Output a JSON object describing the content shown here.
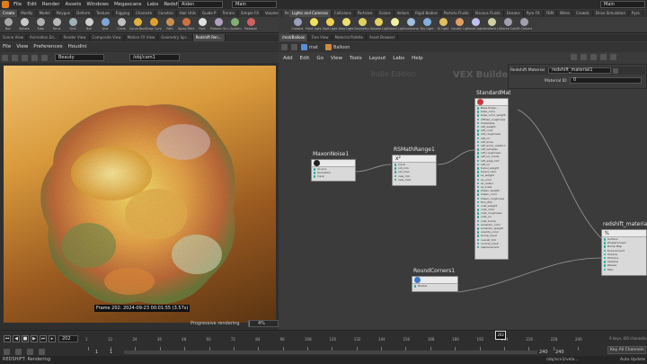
{
  "menubar": {
    "items": [
      "File",
      "Edit",
      "Render",
      "Assets",
      "Windows",
      "Megascans",
      "Labs",
      "Redshift",
      "Help"
    ],
    "desktop": "Aiden",
    "desktop2": "Main"
  },
  "shelf_tabs_left": [
    "Create",
    "Modify",
    "Model",
    "Polygon",
    "Deform",
    "Texture",
    "Rigging",
    "Characte",
    "Constrai",
    "Hair Utils",
    "Guide P",
    "Terrain",
    "Simple FX",
    "Volume",
    "Personal"
  ],
  "shelf_tabs_right": [
    "Lights and Cameras",
    "Collisions",
    "Particles",
    "Grains",
    "Vellum",
    "Rigid Bodies",
    "Particle Fluids",
    "Viscous Fluids",
    "Oceans",
    "Pyro FX",
    "FEM",
    "Wires",
    "Crowds",
    "Drive Simulation",
    "Pyro"
  ],
  "shelf_tools_left": [
    {
      "label": "Box",
      "color": "#a7a7a7"
    },
    {
      "label": "Sphere",
      "color": "#c8c8c8"
    },
    {
      "label": "Tube",
      "color": "#b0b0b0"
    },
    {
      "label": "Torus",
      "color": "#b8b8b8"
    },
    {
      "label": "Grid",
      "color": "#9fb0b8"
    },
    {
      "label": "Null",
      "color": "#d0d0d0"
    },
    {
      "label": "Line",
      "color": "#7fa6d8"
    },
    {
      "label": "Circle",
      "color": "#c0c0c0"
    },
    {
      "label": "Curve Bezier",
      "color": "#e0b040"
    },
    {
      "label": "Draw Curve",
      "color": "#e0a030"
    },
    {
      "label": "Path",
      "color": "#c89050"
    },
    {
      "label": "Spray Paint",
      "color": "#d07040"
    },
    {
      "label": "Font",
      "color": "#e0e0e0"
    },
    {
      "label": "Platonic Solids",
      "color": "#b0a0c0"
    },
    {
      "label": "L-System",
      "color": "#7fb070"
    },
    {
      "label": "Metaball",
      "color": "#d06060"
    }
  ],
  "shelf_tools_right": [
    {
      "label": "Camera",
      "color": "#9aa0c0"
    },
    {
      "label": "Point Light",
      "color": "#f0e060"
    },
    {
      "label": "Spot Light",
      "color": "#f0d050"
    },
    {
      "label": "Area Light",
      "color": "#f0e070"
    },
    {
      "label": "Geometry Light",
      "color": "#e0d060"
    },
    {
      "label": "Volume Light",
      "color": "#e8d060"
    },
    {
      "label": "Distant Light",
      "color": "#f0f0a0"
    },
    {
      "label": "Environment Light",
      "color": "#a0c0e0"
    },
    {
      "label": "Sky Light",
      "color": "#80b0e0"
    },
    {
      "label": "GI Light",
      "color": "#e0c060"
    },
    {
      "label": "Caustic Light",
      "color": "#e0a060"
    },
    {
      "label": "Portal Light",
      "color": "#c0c0f0"
    },
    {
      "label": "Ambient Light",
      "color": "#d0d0a0"
    },
    {
      "label": "Stereo Camera",
      "color": "#a0a0b0"
    },
    {
      "label": "VR Camera",
      "color": "#a0a0b0"
    }
  ],
  "pane_tabs_left": [
    "Scene View",
    "Animation Ed...",
    "Render View",
    "Composite View",
    "Motion FX View",
    "Geometry Spr...",
    "Redshift Ren..."
  ],
  "pane_tabs_right": [
    "/mat/Balloon",
    "Tree View",
    "Material Palette",
    "Asset Browser"
  ],
  "left": {
    "menu": [
      "File",
      "View",
      "Preferences",
      "Houdini"
    ],
    "aov": "Beauty",
    "camera": "/obj/cam1",
    "frame_text": "Frame  202:  2024-09-23  00:01:55  (3.57s)",
    "progress_label": "Progressive rendering",
    "progress_pct": "4%",
    "progress_value": 0.04
  },
  "right": {
    "path_obj": "mat",
    "path_node": "Balloon",
    "menu": [
      "Add",
      "Edit",
      "Go",
      "View",
      "Tools",
      "Layout",
      "Labs",
      "Help"
    ],
    "watermark": "Indie Edition",
    "context": "VEX Builder",
    "param_title": "Redshift Material",
    "param_name": "redshift_material1",
    "param_label": "Material ID",
    "param_value": "0"
  },
  "nodes": {
    "maxon": {
      "name": "MaxonNoise1",
      "rows": [
        "Source",
        "Animation",
        "Input"
      ]
    },
    "range": {
      "name": "RSMathRange1",
      "rows": [
        "Input",
        "old_min",
        "old_max",
        "new_min",
        "new_max"
      ]
    },
    "standard": {
      "name": "StandardMat",
      "rows": [
        "Base Prope...",
        "base_color",
        "base_color_weight",
        "diffuse_roughness",
        "metalness",
        "refl_weight",
        "refl_color",
        "refl_roughness",
        "refl_ior",
        "refl_aniso",
        "refl_aniso_rotation",
        "refl_samples",
        "refl_roughness",
        "refl_ior_mode",
        "refl_edge_tint",
        "refl_ior",
        "transl_weight",
        "transl_color",
        "ss_weight",
        "ss_color",
        "ss_radius",
        "ss_scale",
        "sheen_weight",
        "sheen_color",
        "sheen_roughness",
        "thin_film",
        "coat_weight",
        "coat_color",
        "coat_roughness",
        "coat_ior",
        "coat_bump",
        "emission_color",
        "emission_weight",
        "opacity_color",
        "bump_input",
        "overall_tint",
        "normal_input",
        "displacement"
      ]
    },
    "round": {
      "name": "RoundCorners1",
      "rows": [
        "Radius"
      ]
    },
    "material": {
      "name": "redshift_material",
      "rows": [
        "Surface",
        "Displacement",
        "Bump Map",
        "Environment",
        "Volume",
        "Photons",
        "Shadow",
        "Passes",
        "Misc"
      ]
    }
  },
  "timeline": {
    "current_frame": "202",
    "start": "1",
    "start2": "1",
    "end": "240",
    "end2": "240",
    "ticks": [
      "1",
      "12",
      "24",
      "36",
      "48",
      "60",
      "72",
      "84",
      "96",
      "108",
      "120",
      "132",
      "144",
      "156",
      "168",
      "180",
      "192",
      "204",
      "216",
      "228",
      "240"
    ],
    "keys_label": "0 keys, 0/0 channels",
    "key_all": "Key All Channels",
    "auto_update": "Auto Update",
    "path": "/obj/scn1/vela..."
  },
  "status": "REDSHIFT: Rendering"
}
